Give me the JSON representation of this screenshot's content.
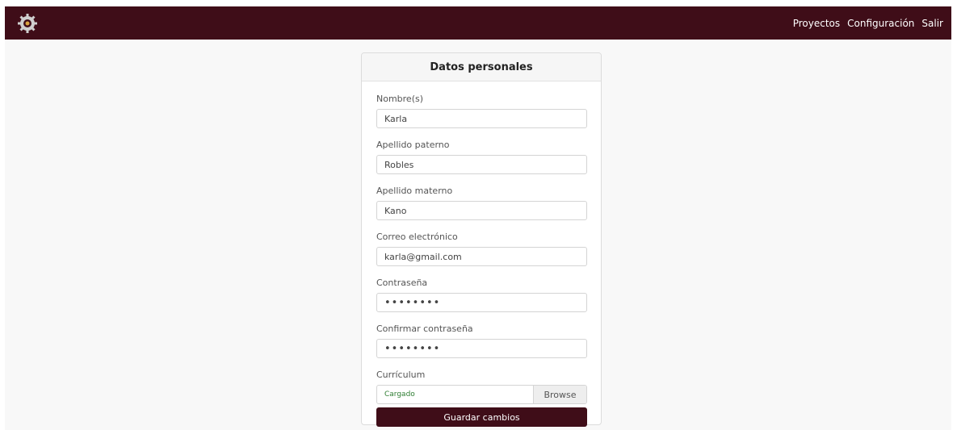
{
  "nav": {
    "logo": "logo-gear-icon",
    "links": [
      "Proyectos",
      "Configuración",
      "Salir"
    ]
  },
  "card": {
    "title": "Datos personales",
    "fields": [
      {
        "label": "Nombre(s)",
        "value": "Karla"
      },
      {
        "label": "Apellido paterno",
        "value": "Robles"
      },
      {
        "label": "Apellido materno",
        "value": "Kano"
      },
      {
        "label": "Correo electrónico",
        "value": "karla@gmail.com"
      },
      {
        "label": "Contraseña",
        "value": "••••••••"
      },
      {
        "label": "Confirmar contraseña",
        "value": "••••••••"
      }
    ],
    "curriculum": {
      "label": "Currículum",
      "status": "Cargado",
      "browse_label": "Browse"
    },
    "save_label": "Guardar cambios"
  },
  "colors": {
    "brand": "#3f0d18",
    "file_status": "#2e7d32"
  }
}
